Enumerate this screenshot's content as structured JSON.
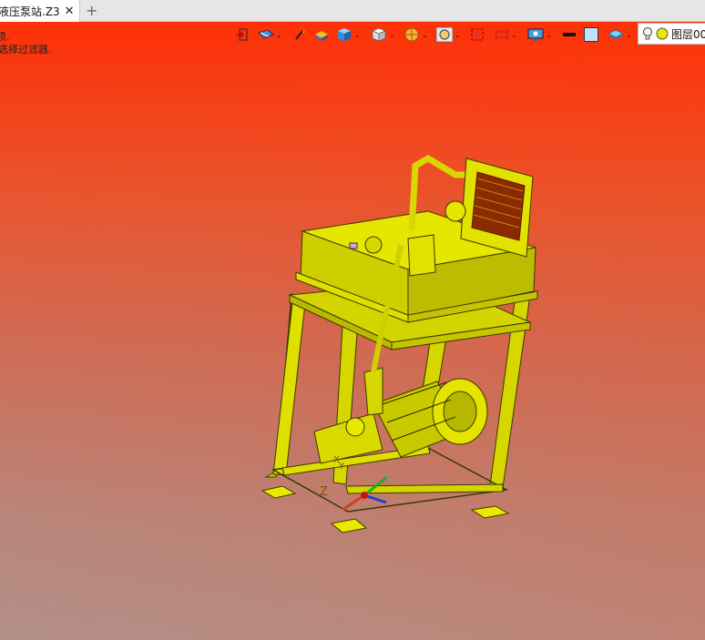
{
  "tab": {
    "title": "液压泵站.Z3",
    "close_glyph": "✕",
    "new_glyph": "+"
  },
  "prompts": {
    "line1": "须.",
    "line2": "选择过滤器."
  },
  "toolbar": {
    "items": [
      "exit-icon",
      "filter-icon",
      "pick-icon",
      "part-color-icon",
      "view-cube-icon",
      "render-cube-icon",
      "section-icon",
      "zoom-icon",
      "fit-icon",
      "frame-icon",
      "display-icon",
      "line-color-icon",
      "fill-color-icon",
      "layer-stack-icon"
    ]
  },
  "layer": {
    "label": "图层00",
    "bulb_icon": "light-bulb-icon",
    "status_color": "#e8e800"
  },
  "triad": {
    "label_z": "Z",
    "label_x": "X",
    "label_y": "Y"
  },
  "colors": {
    "model": "#d4d40a",
    "viewport_top": "#ff2f07",
    "viewport_bottom": "#b39089"
  }
}
